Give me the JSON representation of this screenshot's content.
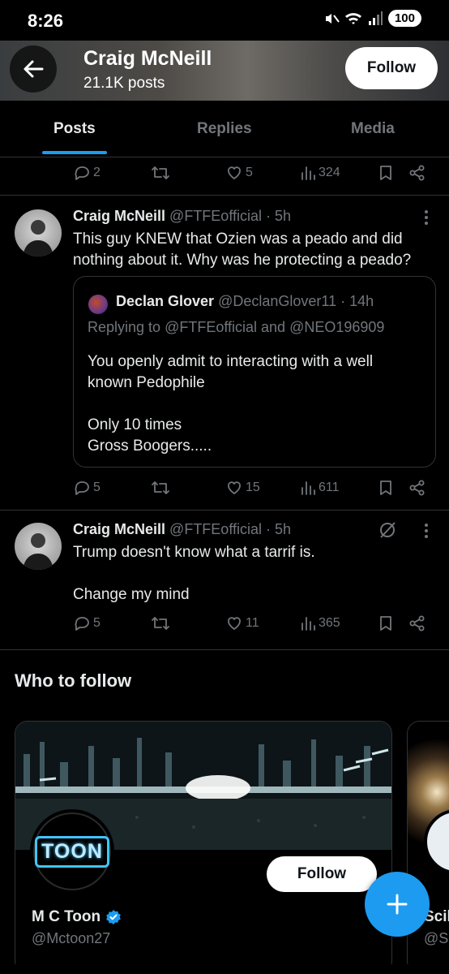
{
  "status_bar": {
    "time": "8:26",
    "battery": "100"
  },
  "header": {
    "name": "Craig McNeill",
    "posts": "21.1K posts",
    "follow_label": "Follow"
  },
  "tabs": [
    {
      "label": "Posts"
    },
    {
      "label": "Replies"
    },
    {
      "label": "Media"
    }
  ],
  "top_actions": {
    "replies": "2",
    "likes": "5",
    "views": "324"
  },
  "tweets": [
    {
      "name": "Craig McNeill",
      "meta": "@FTFEofficial · 5h",
      "text": "This guy KNEW that Ozien was a peado and did nothing about it. Why was he protecting a peado?",
      "quote": {
        "name": "Declan Glover",
        "meta": "@DeclanGlover11 · 14h",
        "reply_prefix": "Replying to ",
        "reply_user1": "@FTFEofficial",
        "reply_and": " and ",
        "reply_user2": "@NEO196909",
        "line1": "You openly admit to interacting with a well known Pedophile",
        "line2": "Only 10 times",
        "line3": "Gross Boogers....."
      },
      "replies": "5",
      "likes": "15",
      "views": "611"
    },
    {
      "name": "Craig McNeill",
      "meta": "@FTFEofficial · 5h",
      "line1": "Trump doesn't know what a tarrif is.",
      "line2": "Change my mind",
      "replies": "5",
      "likes": "11",
      "views": "365"
    }
  ],
  "who_to_follow": {
    "title": "Who to follow",
    "cards": [
      {
        "name": "M C Toon",
        "handle": "@Mctoon27",
        "follow_label": "Follow",
        "logo_text": "TOON"
      },
      {
        "name": "Scil",
        "handle": "@Sc"
      }
    ]
  },
  "colors": {
    "accent": "#1d9bf0",
    "muted": "#71767b",
    "divider": "#2f3336"
  }
}
